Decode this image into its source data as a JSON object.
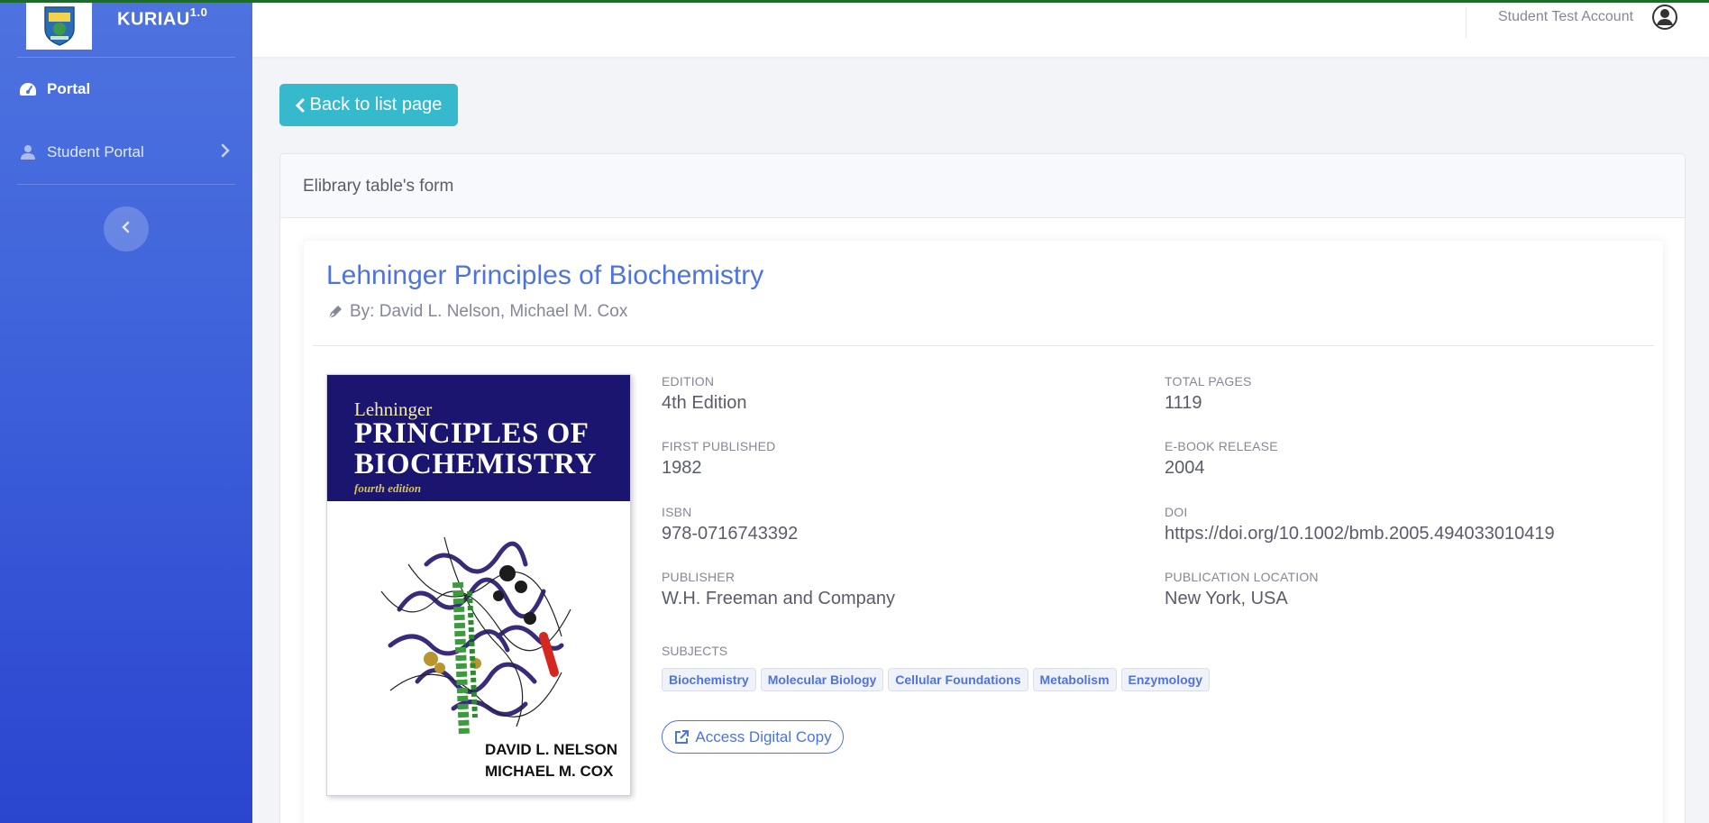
{
  "brand": {
    "name": "KURIAU",
    "version": "1.0"
  },
  "sidebar": {
    "items": [
      {
        "label": "Portal",
        "icon": "dashboard-icon"
      },
      {
        "label": "Student Portal",
        "icon": "user-icon"
      }
    ]
  },
  "topbar": {
    "user_name": "Student Test Account"
  },
  "back_button": {
    "label": "Back to list page"
  },
  "card": {
    "header": "Elibrary table's form"
  },
  "book": {
    "title": "Lehninger Principles of Biochemistry",
    "author_line": "By: David L. Nelson, Michael M. Cox",
    "cover": {
      "line1": "Lehninger",
      "line2": "PRINCIPLES OF",
      "line3": "BIOCHEMISTRY",
      "line4": "fourth edition",
      "author1": "DAVID L. NELSON",
      "author2": "MICHAEL M. COX"
    },
    "fields": {
      "edition": {
        "label": "EDITION",
        "value": "4th Edition"
      },
      "total_pages": {
        "label": "TOTAL PAGES",
        "value": "1119"
      },
      "first_published": {
        "label": "FIRST PUBLISHED",
        "value": "1982"
      },
      "ebook_release": {
        "label": "E-BOOK RELEASE",
        "value": "2004"
      },
      "isbn": {
        "label": "ISBN",
        "value": "978-0716743392"
      },
      "doi": {
        "label": "DOI",
        "value": "https://doi.org/10.1002/bmb.2005.494033010419"
      },
      "publisher": {
        "label": "PUBLISHER",
        "value": "W.H. Freeman and Company"
      },
      "publication_location": {
        "label": "PUBLICATION LOCATION",
        "value": "New York, USA"
      }
    },
    "subjects_label": "SUBJECTS",
    "subjects": [
      "Biochemistry",
      "Molecular Biology",
      "Cellular Foundations",
      "Metabolism",
      "Enzymology"
    ],
    "access_label": "Access Digital Copy"
  },
  "colors": {
    "primary": "#4e73df",
    "info": "#36b9cc",
    "sidebar_top": "#4e73df",
    "sidebar_bottom": "#2b45cf",
    "cover_band": "#1a1670"
  }
}
